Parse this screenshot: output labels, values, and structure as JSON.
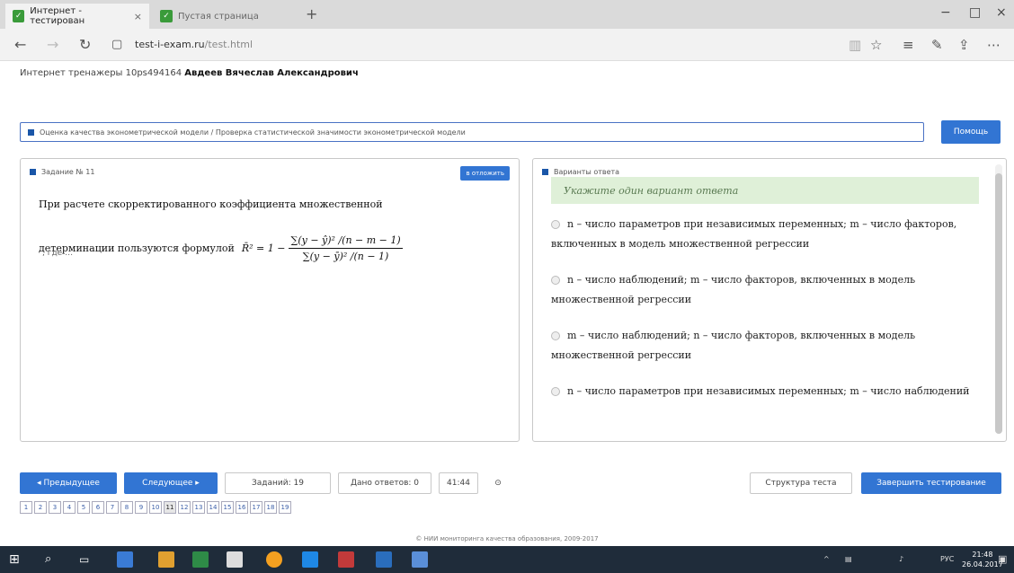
{
  "browser": {
    "tabs": [
      {
        "label": "Интернет - тестирован",
        "close": "×"
      },
      {
        "label": "Пустая страница"
      }
    ],
    "new_tab": "+",
    "win_min": "−",
    "win_max": "□",
    "win_close": "×",
    "url_domain": "test-i-exam.ru",
    "url_path": "/test.html"
  },
  "page": {
    "user_line_prefix": "Интернет тренажеры 10ps494164",
    "user_name": "Авдеев Вячеслав Александрович",
    "breadcrumb": "Оценка качества эконометрической модели / Проверка статистической значимости эконометрической модели",
    "help_label": "Помощь"
  },
  "task": {
    "header": "Задание № 11",
    "postpone_label": "в отложить",
    "question_line1": "При расчете скорректированного коэффициента множественной",
    "question_line2": "детерминации пользуются формулой",
    "formula_lhs": "R̄² = 1 −",
    "formula_num": "∑(y − ŷ)² /(n − m − 1)",
    "formula_den": "∑(y − ȳ)² /(n − 1)",
    "where": ", где …"
  },
  "answers": {
    "header": "Варианты ответа",
    "hint": "Укажите один вариант ответа",
    "options": [
      "n – число параметров при независимых переменных; m – число факторов, включенных в модель множественной регрессии",
      "n – число наблюдений; m – число факторов, включенных в модель множественной регрессии",
      "m – число наблюдений; n – число факторов, включенных в модель множественной регрессии",
      "n – число параметров при независимых переменных; m – число наблюдений"
    ]
  },
  "controls": {
    "prev_label": "◂ Предыдущее",
    "next_label": "Следующее ▸",
    "tasks_count": "Заданий: 19",
    "answered": "Дано ответов: 0",
    "timer": "41:44",
    "structure_label": "Структура теста",
    "finish_label": "Завершить тестирование",
    "pages": [
      "1",
      "2",
      "3",
      "4",
      "5",
      "6",
      "7",
      "8",
      "9",
      "10",
      "11",
      "12",
      "13",
      "14",
      "15",
      "16",
      "17",
      "18",
      "19"
    ],
    "current_page": "11"
  },
  "footer": "© НИИ мониторинга качества образования, 2009-2017",
  "taskbar": {
    "lang": "РУС",
    "time": "21:48",
    "date": "26.04.2017"
  },
  "colors": {
    "accent": "#3275d3",
    "hint_bg": "#dff0d8",
    "taskbar": "#1f2c3a"
  }
}
